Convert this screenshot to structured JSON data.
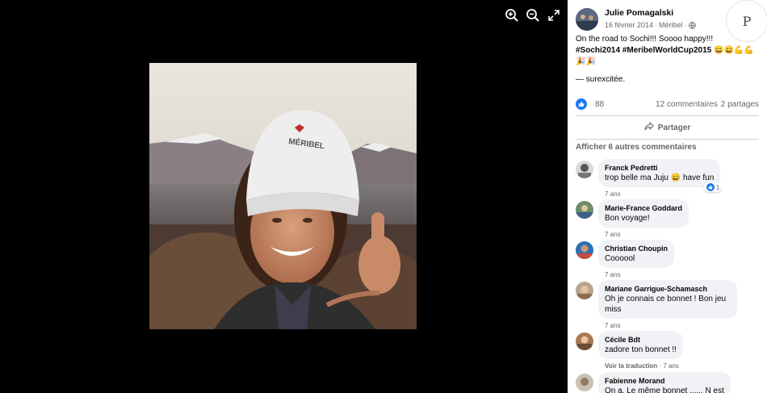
{
  "viewer": {
    "controls": [
      {
        "icon": "zoom-in-icon"
      },
      {
        "icon": "zoom-out-icon"
      },
      {
        "icon": "fullscreen-icon"
      }
    ]
  },
  "post": {
    "author": "Julie Pomagalski",
    "date": "16 février 2014",
    "separator": "·",
    "location": "Méribel",
    "privacy_icon": "globe-icon",
    "text_line1": "On the road to Sochi!!! Soooo happy!!!",
    "hashtags": "#Sochi2014 #MeribelWorldCup2015",
    "emojis": "😄😄💪💪🎉🎉",
    "feeling": "— surexcitée.",
    "watermark": "P"
  },
  "stats": {
    "likes": "88",
    "comments": "12 commentaires",
    "shares": "2 partages"
  },
  "actions": {
    "share_label": "Partager",
    "more_comments": "Afficher 6 autres commentaires"
  },
  "comments": [
    {
      "name": "Franck Pedretti",
      "text": "trop belle ma Juju 😄 have fun",
      "time": "7 ans",
      "reactions": "1"
    },
    {
      "name": "Marie-France Goddard",
      "text": "Bon voyage!",
      "time": "7 ans"
    },
    {
      "name": "Christian Choupin",
      "text": "Coooool",
      "time": "7 ans"
    },
    {
      "name": "Mariane Garrigue-Schamasch",
      "text_line1": "Oh je connais ce bonnet ! Bon jeu",
      "text_line2": "miss",
      "time": "7 ans"
    },
    {
      "name": "Cécile Bdt",
      "text": "zadore ton bonnet !!",
      "translate": "Voir la traduction",
      "time": "· 7 ans"
    },
    {
      "name": "Fabienne Morand",
      "text": "On a. Le même bonnet ...... N est"
    }
  ],
  "colors": {
    "accent": "#1877f2",
    "bubble": "#f0f2f5",
    "secondary_text": "#65676b"
  }
}
